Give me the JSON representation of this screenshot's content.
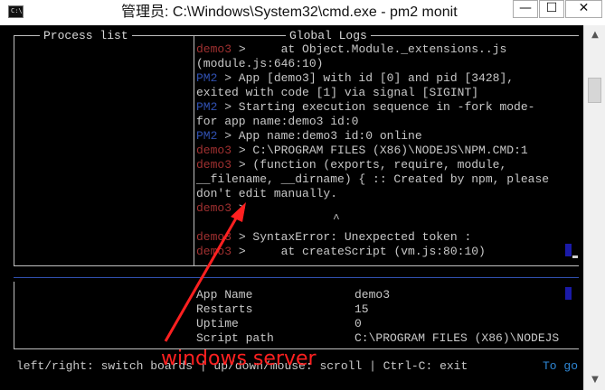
{
  "window": {
    "title": "管理员: C:\\Windows\\System32\\cmd.exe - pm2  monit",
    "icon": "C:\\",
    "minimize": "—",
    "maximize": "☐",
    "close": "✕"
  },
  "process_list": {
    "title": "Process list"
  },
  "global_logs": {
    "title": "Global Logs",
    "lines": [
      {
        "prefix": "demo3",
        "prefix_color": "#a03030",
        "text": " >     at Object.Module._extensions..js"
      },
      {
        "prefix": "",
        "prefix_color": "",
        "text": "(module.js:646:10)"
      },
      {
        "prefix": "PM2",
        "prefix_color": "#3050b0",
        "text": " > App [demo3] with id [0] and pid [3428],"
      },
      {
        "prefix": "",
        "prefix_color": "",
        "text": "exited with code [1] via signal [SIGINT]"
      },
      {
        "prefix": "PM2",
        "prefix_color": "#3050b0",
        "text": " > Starting execution sequence in -fork mode-"
      },
      {
        "prefix": "",
        "prefix_color": "",
        "text": "for app name:demo3 id:0"
      },
      {
        "prefix": "PM2",
        "prefix_color": "#3050b0",
        "text": " > App name:demo3 id:0 online"
      },
      {
        "prefix": "demo3",
        "prefix_color": "#a03030",
        "text": " > C:\\PROGRAM FILES (X86)\\NODEJS\\NPM.CMD:1"
      },
      {
        "prefix": "demo3",
        "prefix_color": "#a03030",
        "text": " > (function (exports, require, module,"
      },
      {
        "prefix": "",
        "prefix_color": "",
        "text": "__filename, __dirname) { :: Created by npm, please"
      },
      {
        "prefix": "",
        "prefix_color": "",
        "text": "don't edit manually."
      },
      {
        "prefix": "demo3",
        "prefix_color": "#a03030",
        "text": " >"
      },
      {
        "prefix": "",
        "prefix_color": "",
        "text": ""
      },
      {
        "prefix": "demo3",
        "prefix_color": "#a03030",
        "text": " > SyntaxError: Unexpected token :"
      },
      {
        "prefix": "demo3",
        "prefix_color": "#a03030",
        "text": " >     at createScript (vm.js:80:10)"
      }
    ],
    "caret": "^"
  },
  "details": [
    {
      "key": "App Name",
      "value": "demo3"
    },
    {
      "key": "Restarts",
      "value": "15"
    },
    {
      "key": "Uptime",
      "value": "0"
    },
    {
      "key": "Script path",
      "value": "C:\\PROGRAM FILES (X86)\\NODEJS"
    }
  ],
  "footer": {
    "help": "left/right: switch boards | up/down/mouse: scroll | Ctrl-C: exit",
    "togo": "To go"
  },
  "annotation": {
    "label": "windows server",
    "color": "#ff2020"
  }
}
